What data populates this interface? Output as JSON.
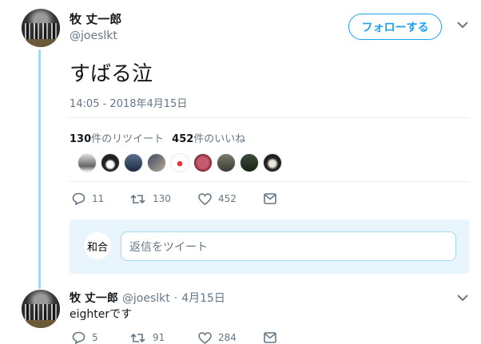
{
  "main_tweet": {
    "author_name": "牧 丈一郎",
    "author_handle": "@joeslkt",
    "follow_label": "フォローする",
    "text": "すばる泣",
    "timestamp": "14:05 - 2018年4月15日",
    "retweet_count": "130",
    "retweet_label": "件のリツイート",
    "like_count": "452",
    "like_label": "件のいいね",
    "actions": {
      "reply": "11",
      "retweet": "130",
      "like": "452"
    }
  },
  "reply_box": {
    "placeholder": "返信をツイート",
    "avatar_text": "和合"
  },
  "reply_tweet": {
    "author_name": "牧 丈一郎",
    "author_handle": "@joeslkt",
    "separator": "·",
    "date": "4月15日",
    "text": "eighterです",
    "actions": {
      "reply": "5",
      "retweet": "91",
      "like": "284"
    }
  },
  "colors": {
    "accent": "#1da1f2",
    "thread_line": "#a4d9f0",
    "muted": "#657786"
  },
  "icons": [
    "chevron-down-icon",
    "reply-icon",
    "retweet-icon",
    "like-icon",
    "message-icon"
  ]
}
